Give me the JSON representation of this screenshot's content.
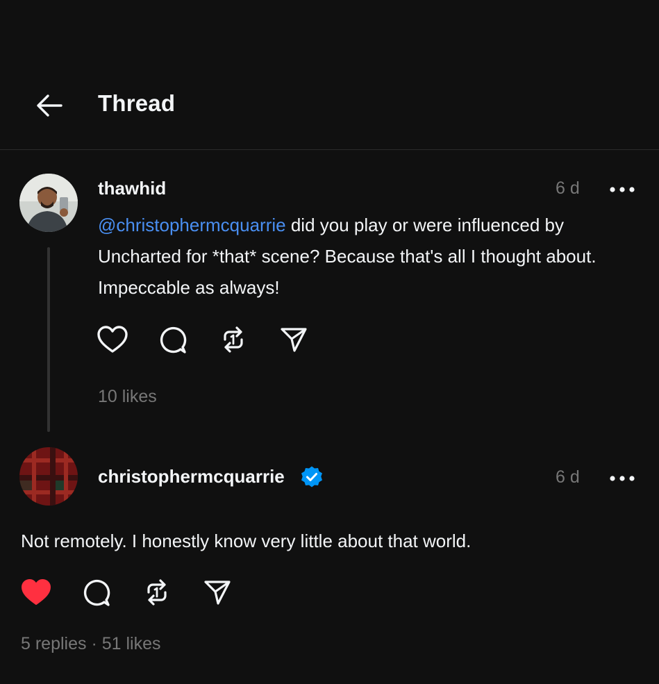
{
  "header": {
    "title": "Thread",
    "back_icon": "arrow-left-icon"
  },
  "posts": [
    {
      "username": "thawhid",
      "time": "6 d",
      "mention": "@christophermcquarrie",
      "text": " did you play or were influenced by Uncharted for *that* scene? Because that's all I thought about. Impeccable as always!",
      "likes": "10 likes",
      "liked": false,
      "verified": false
    },
    {
      "username": "christophermcquarrie",
      "time": "6 d",
      "text": "Not remotely. I honestly know very little about that world.",
      "replies": "5 replies",
      "separator": "·",
      "likes": "51 likes",
      "liked": true,
      "verified": true
    }
  ],
  "colors": {
    "background": "#101010",
    "text": "#f3f5f7",
    "muted": "#777777",
    "mention": "#4a8ff2",
    "like_active": "#ff3040",
    "verified": "#0095f6"
  }
}
